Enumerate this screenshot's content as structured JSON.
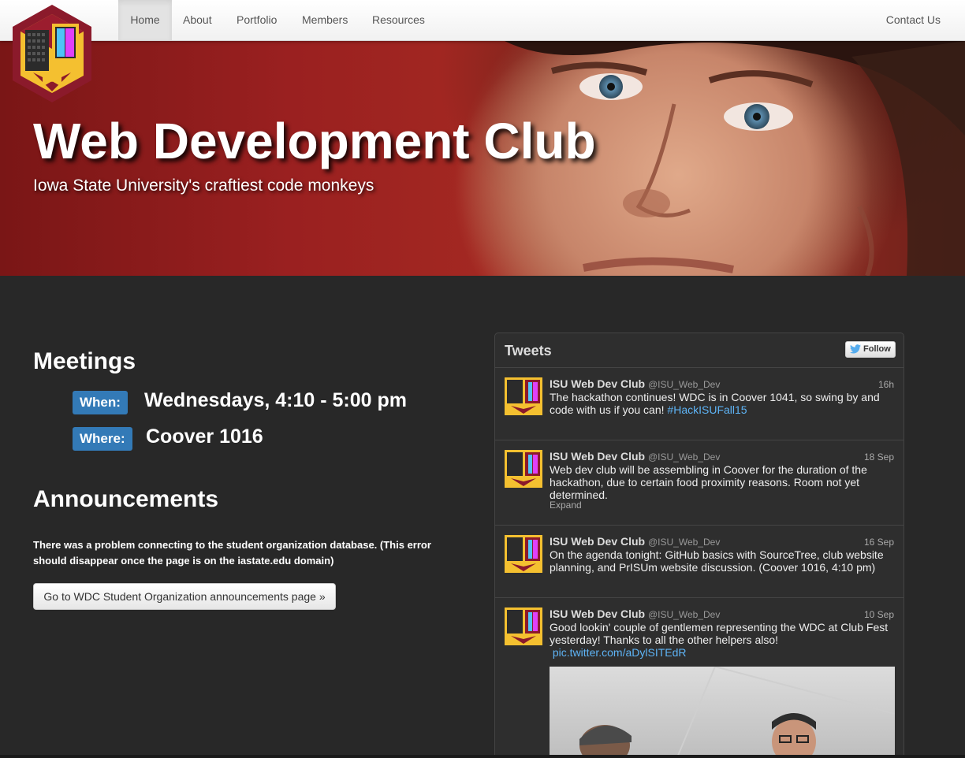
{
  "navbar": {
    "items": [
      {
        "label": "Home",
        "active": true
      },
      {
        "label": "About"
      },
      {
        "label": "Portfolio"
      },
      {
        "label": "Members"
      },
      {
        "label": "Resources"
      }
    ],
    "contact_label": "Contact Us"
  },
  "hero": {
    "title": "Web Development Club",
    "subtitle": "Iowa State University's craftiest code monkeys"
  },
  "meetings": {
    "heading": "Meetings",
    "when_label": "When:",
    "when_value": "Wednesdays, 4:10 - 5:00 pm",
    "where_label": "Where:",
    "where_value": "Coover 1016"
  },
  "announcements": {
    "heading": "Announcements",
    "error_text": "There was a problem connecting to the student organization database. (This error should disappear once the page is on the iastate.edu domain)",
    "button_label": "Go to WDC Student Organization announcements page »"
  },
  "tweets": {
    "title": "Tweets",
    "follow_label": "Follow",
    "items": [
      {
        "name": "ISU Web Dev Club",
        "handle": "@ISU_Web_Dev",
        "time": "16h",
        "text": "The hackathon continues! WDC is in Coover 1041, so swing by and code with us if you can!",
        "link": "#HackISUFall15"
      },
      {
        "name": "ISU Web Dev Club",
        "handle": "@ISU_Web_Dev",
        "time": "18 Sep",
        "text": "Web dev club will be assembling in Coover for the duration of the hackathon, due to certain food proximity reasons. Room not yet determined.",
        "expand": "Expand"
      },
      {
        "name": "ISU Web Dev Club",
        "handle": "@ISU_Web_Dev",
        "time": "16 Sep",
        "text": "On the agenda tonight: GitHub basics with SourceTree, club website planning, and PrISUm website discussion. (Coover 1016, 4:10 pm)"
      },
      {
        "name": "ISU Web Dev Club",
        "handle": "@ISU_Web_Dev",
        "time": "10 Sep",
        "text": "Good lookin' couple of gentlemen representing the WDC at Club Fest yesterday! Thanks to all the other helpers also!",
        "link": "pic.twitter.com/aDylSITEdR"
      }
    ]
  },
  "colors": {
    "badge": "#337ab7",
    "background": "#282828",
    "link": "#5eb4f6",
    "logo_gold": "#f4c030",
    "logo_maroon": "#8b1a2b"
  }
}
